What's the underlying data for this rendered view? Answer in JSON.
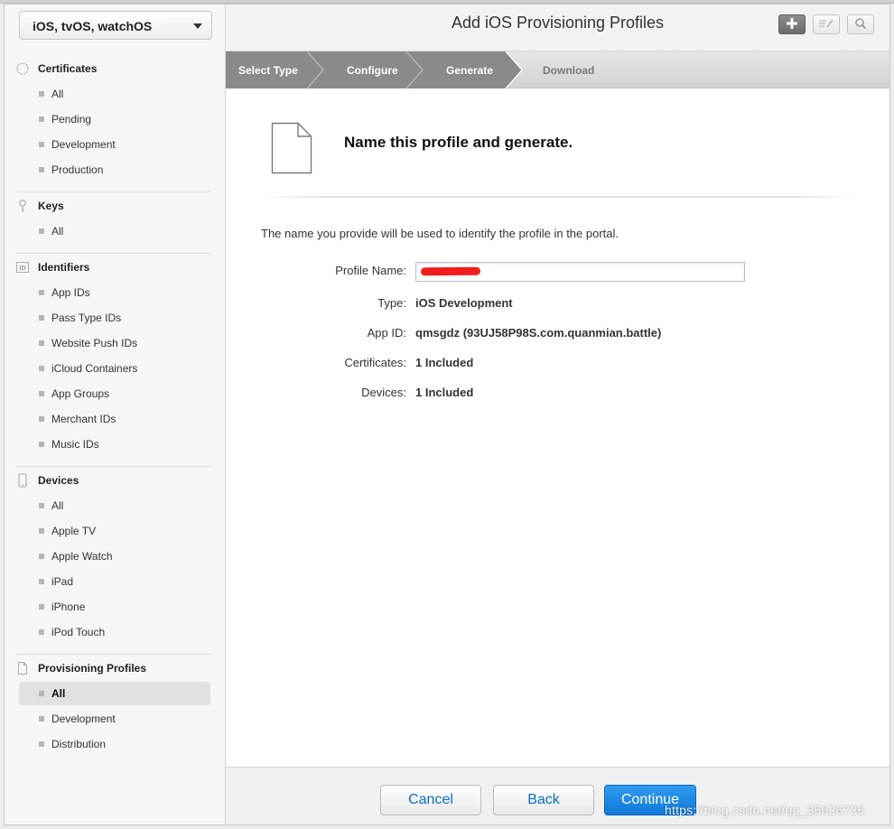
{
  "sidebar": {
    "platform": "iOS, tvOS, watchOS",
    "sections": {
      "certificates": {
        "title": "Certificates",
        "items": [
          "All",
          "Pending",
          "Development",
          "Production"
        ]
      },
      "keys": {
        "title": "Keys",
        "items": [
          "All"
        ]
      },
      "identifiers": {
        "title": "Identifiers",
        "icon_text": "ID",
        "items": [
          "App IDs",
          "Pass Type IDs",
          "Website Push IDs",
          "iCloud Containers",
          "App Groups",
          "Merchant IDs",
          "Music IDs"
        ]
      },
      "devices": {
        "title": "Devices",
        "items": [
          "All",
          "Apple TV",
          "Apple Watch",
          "iPad",
          "iPhone",
          "iPod Touch"
        ]
      },
      "profiles": {
        "title": "Provisioning Profiles",
        "items": [
          "All",
          "Development",
          "Distribution"
        ],
        "active_index": 0
      }
    }
  },
  "header": {
    "title": "Add iOS Provisioning Profiles"
  },
  "steps": [
    {
      "label": "Select Type",
      "state": "done"
    },
    {
      "label": "Configure",
      "state": "done"
    },
    {
      "label": "Generate",
      "state": "done"
    },
    {
      "label": "Download",
      "state": "pending"
    }
  ],
  "content": {
    "heading": "Name this profile and generate.",
    "intro": "The name you provide will be used to identify the profile in the portal.",
    "fields": {
      "profile_name_label": "Profile Name:",
      "type_label": "Type:",
      "type_value": "iOS Development",
      "app_id_label": "App ID:",
      "app_id_value": "qmsgdz (93UJ58P98S.com.quanmian.battle)",
      "certificates_label": "Certificates:",
      "certificates_value": "1 Included",
      "devices_label": "Devices:",
      "devices_value": "1 Included"
    }
  },
  "footer": {
    "cancel": "Cancel",
    "back": "Back",
    "continue": "Continue"
  },
  "watermark": "https://blog.csdn.net/qq_35626736",
  "colors": {
    "step_active": "#8a8a8a",
    "primary_button": "#1a85e0",
    "link_blue": "#0a6fc2",
    "redaction": "#f11d1d"
  }
}
